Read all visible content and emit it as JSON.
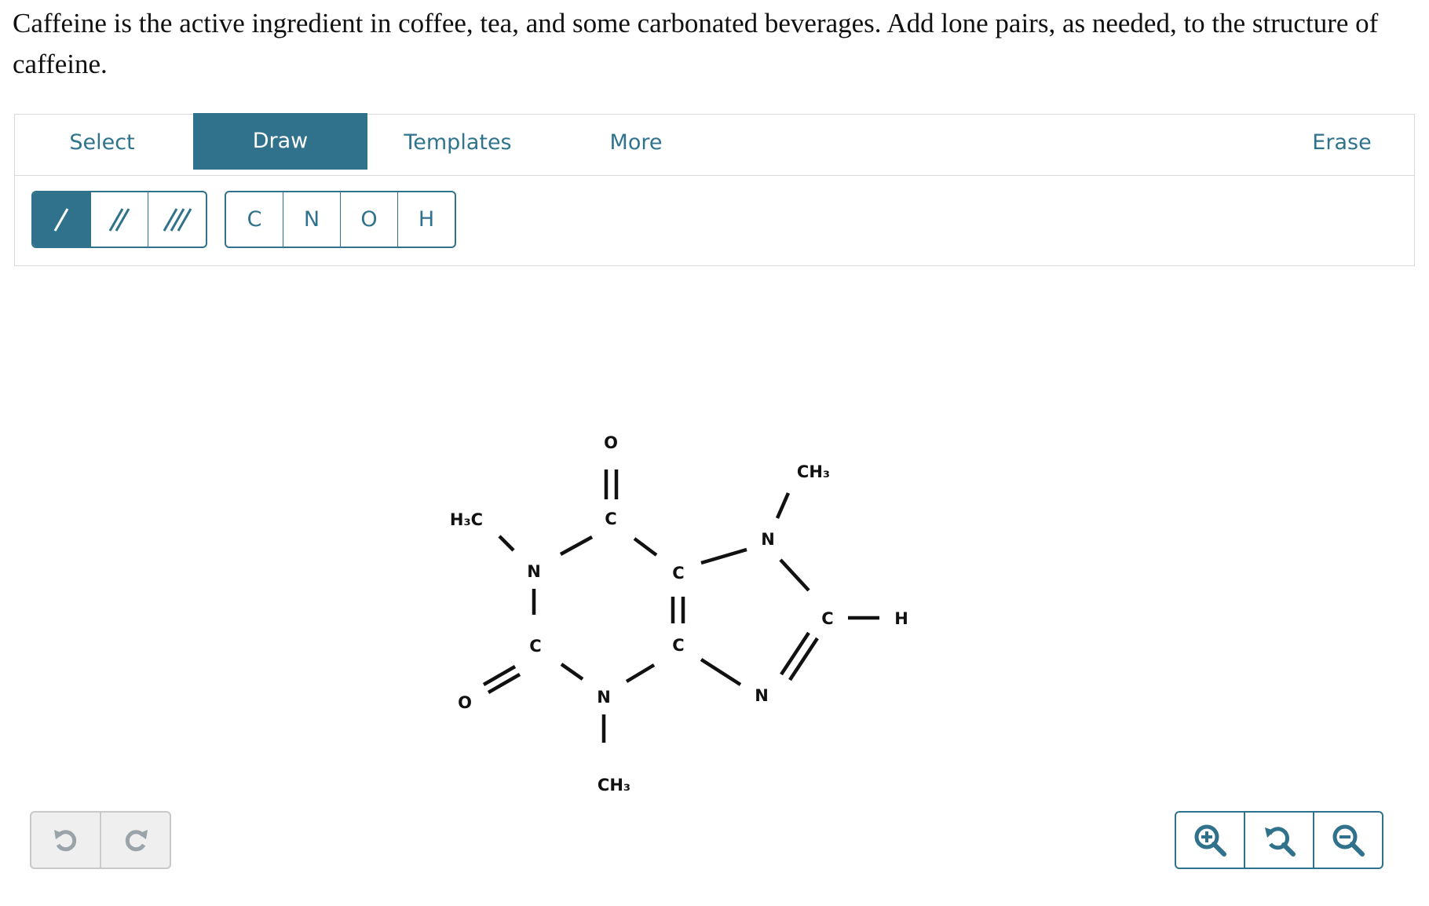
{
  "question": {
    "text": "Caffeine is the active ingredient in coffee, tea, and some carbonated beverages. Add lone pairs, as needed, to the structure of caffeine."
  },
  "tabs": {
    "select": "Select",
    "draw": "Draw",
    "templates": "Templates",
    "more": "More",
    "erase": "Erase"
  },
  "toolbar": {
    "bonds": [
      "single-bond-icon",
      "double-bond-icon",
      "triple-bond-icon"
    ],
    "atoms": [
      "C",
      "N",
      "O",
      "H"
    ]
  },
  "molecule": {
    "labels": {
      "o_top": "O",
      "c_carbonyl_top": "C",
      "h3c_left": "H₃C",
      "n_left": "N",
      "c_left": "C",
      "o_left": "O",
      "n_bottom": "N",
      "ch3_bottom": "CH₃",
      "c_fused_top": "C",
      "c_fused_bottom": "C",
      "n_right_top": "N",
      "ch3_right": "CH₃",
      "c_right": "C",
      "h_right": "H",
      "n_right_bottom": "N"
    }
  },
  "accent_color": "#30728b",
  "icons": {
    "undo": "undo-icon",
    "redo": "redo-icon",
    "zoom_in": "zoom-in-icon",
    "zoom_reset": "zoom-reset-icon",
    "zoom_out": "zoom-out-icon"
  }
}
